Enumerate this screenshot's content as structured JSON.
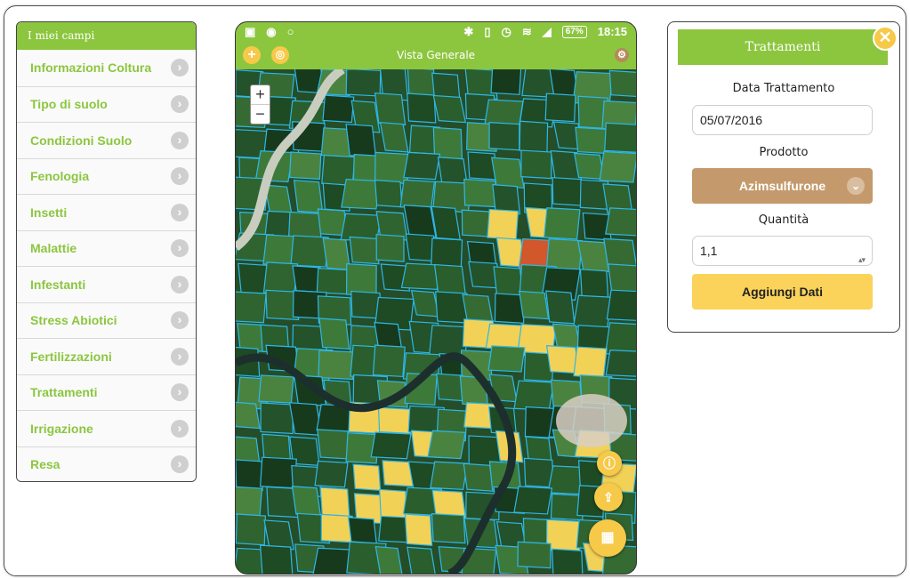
{
  "menu": {
    "header": "I miei campi",
    "items": [
      {
        "label": "Informazioni Coltura"
      },
      {
        "label": "Tipo di suolo"
      },
      {
        "label": "Condizioni Suolo"
      },
      {
        "label": "Fenologia"
      },
      {
        "label": "Insetti"
      },
      {
        "label": "Malattie"
      },
      {
        "label": "Infestanti"
      },
      {
        "label": "Stress Abiotici"
      },
      {
        "label": "Fertilizzazioni"
      },
      {
        "label": "Trattamenti"
      },
      {
        "label": "Irrigazione"
      },
      {
        "label": "Resa"
      }
    ]
  },
  "phone": {
    "status": {
      "battery": "67%",
      "time": "18:15"
    },
    "appbar": {
      "title": "Vista Generale"
    },
    "zoom": {
      "in": "+",
      "out": "−"
    }
  },
  "form": {
    "title": "Trattamenti",
    "date_label": "Data Trattamento",
    "date_value": "05/07/2016",
    "product_label": "Prodotto",
    "product_value": "Azimsulfurone",
    "quantity_label": "Quantità",
    "quantity_value": "1,1",
    "submit_label": "Aggiungi Dati"
  },
  "colors": {
    "accent_green": "#8cc63f",
    "accent_yellow": "#f7c948",
    "select_brown": "#c49a6c",
    "field_yellow": "#f2d157",
    "field_orange": "#d2572a",
    "field_border": "#2fb7e8"
  },
  "icons": [
    "chevron-right-icon",
    "add-icon",
    "layers-icon",
    "settings-icon",
    "info-icon",
    "share-icon",
    "grid-icon",
    "close-icon",
    "chevron-down-icon",
    "bluetooth-icon",
    "wifi-icon",
    "signal-icon",
    "alarm-icon"
  ]
}
